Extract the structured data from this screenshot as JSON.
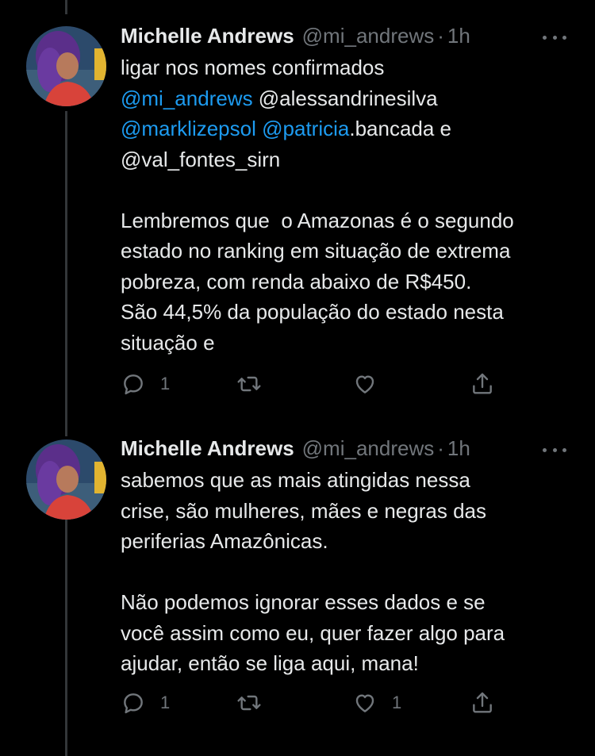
{
  "colors": {
    "background": "#000000",
    "text": "#e7e9ea",
    "muted": "#71767b",
    "mention": "#1d9bf0",
    "thread_line": "#333639"
  },
  "tweets": [
    {
      "author": {
        "name": "Michelle Andrews",
        "handle": "@mi_andrews",
        "separator": "·",
        "time": "1h"
      },
      "lines": [
        [
          {
            "t": "ligar nos nomes confirmados",
            "m": false
          }
        ],
        [
          {
            "t": "@mi_andrews",
            "m": true
          },
          {
            "t": " @alessandrinesilva",
            "m": false
          }
        ],
        [
          {
            "t": "@marklizepsol",
            "m": true
          },
          {
            "t": " ",
            "m": false
          },
          {
            "t": "@patricia",
            "m": true
          },
          {
            "t": ".bancada e",
            "m": false
          }
        ],
        [
          {
            "t": "@val_fontes_sirn",
            "m": false
          }
        ],
        [],
        [
          {
            "t": "Lembremos que  o Amazonas é o segundo",
            "m": false
          }
        ],
        [
          {
            "t": "estado no ranking em situação de extrema",
            "m": false
          }
        ],
        [
          {
            "t": "pobreza, com renda abaixo de R$450.",
            "m": false
          }
        ],
        [
          {
            "t": "São 44,5% da população do estado nesta",
            "m": false
          }
        ],
        [
          {
            "t": "situação e",
            "m": false
          }
        ]
      ],
      "actions": {
        "reply_count": "1",
        "retweet_count": "",
        "like_count": ""
      }
    },
    {
      "author": {
        "name": "Michelle Andrews",
        "handle": "@mi_andrews",
        "separator": "·",
        "time": "1h"
      },
      "lines": [
        [
          {
            "t": "sabemos que as mais atingidas nessa",
            "m": false
          }
        ],
        [
          {
            "t": "crise, são mulheres, mães e negras das",
            "m": false
          }
        ],
        [
          {
            "t": "periferias Amazônicas.",
            "m": false
          }
        ],
        [],
        [
          {
            "t": "Não podemos ignorar esses dados e se",
            "m": false
          }
        ],
        [
          {
            "t": "você assim como eu, quer fazer algo para",
            "m": false
          }
        ],
        [
          {
            "t": "ajudar, então se liga aqui, mana!",
            "m": false
          }
        ]
      ],
      "actions": {
        "reply_count": "1",
        "retweet_count": "",
        "like_count": "1"
      }
    }
  ]
}
